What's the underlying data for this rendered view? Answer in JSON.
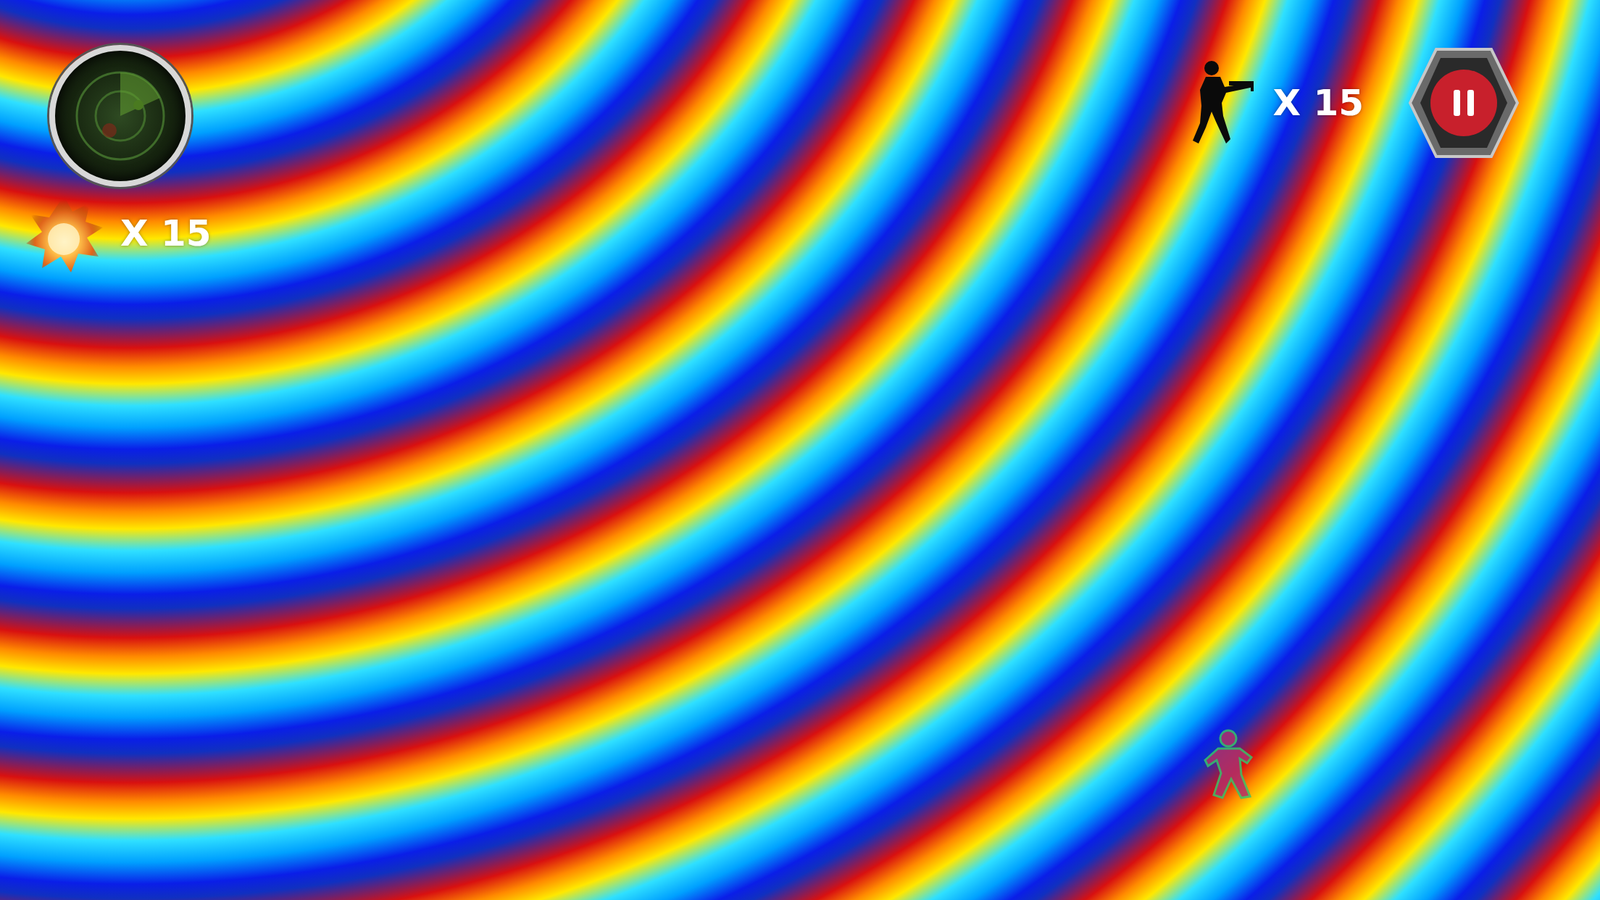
{
  "hud": {
    "grenades": {
      "count": "X 15"
    },
    "enemies": {
      "count": "X 15"
    },
    "pause": {
      "paused": false
    }
  },
  "player": {
    "visible": true
  }
}
